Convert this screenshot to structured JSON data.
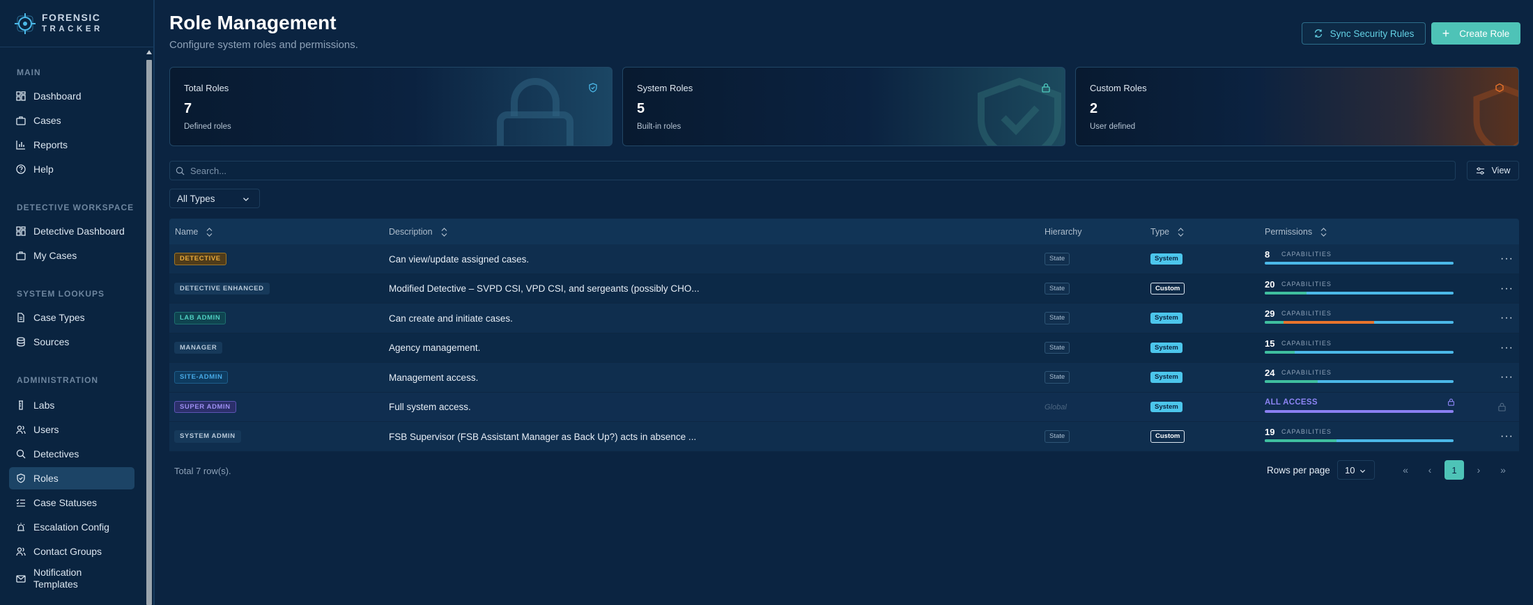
{
  "brand": {
    "line1": "FORENSIC",
    "line2": "TRACKER"
  },
  "sidebar": {
    "sections": [
      {
        "title": "MAIN",
        "items": [
          {
            "label": "Dashboard",
            "icon": "dashboard-icon"
          },
          {
            "label": "Cases",
            "icon": "briefcase-icon"
          },
          {
            "label": "Reports",
            "icon": "bar-chart-icon"
          },
          {
            "label": "Help",
            "icon": "help-circle-icon"
          }
        ]
      },
      {
        "title": "DETECTIVE WORKSPACE",
        "items": [
          {
            "label": "Detective Dashboard",
            "icon": "dashboard-icon"
          },
          {
            "label": "My Cases",
            "icon": "briefcase-icon"
          }
        ]
      },
      {
        "title": "SYSTEM LOOKUPS",
        "items": [
          {
            "label": "Case Types",
            "icon": "file-icon"
          },
          {
            "label": "Sources",
            "icon": "database-icon"
          }
        ]
      },
      {
        "title": "ADMINISTRATION",
        "items": [
          {
            "label": "Labs",
            "icon": "flask-icon"
          },
          {
            "label": "Users",
            "icon": "users-icon"
          },
          {
            "label": "Detectives",
            "icon": "search-icon"
          },
          {
            "label": "Roles",
            "icon": "shield-check-icon",
            "active": true
          },
          {
            "label": "Case Statuses",
            "icon": "list-check-icon"
          },
          {
            "label": "Escalation Config",
            "icon": "siren-icon"
          },
          {
            "label": "Contact Groups",
            "icon": "users-icon"
          },
          {
            "label": "Notification Templates",
            "icon": "mail-icon"
          }
        ]
      }
    ]
  },
  "header": {
    "title": "Role Management",
    "subtitle": "Configure system roles and permissions.",
    "sync_label": "Sync Security Rules",
    "create_label": "Create Role"
  },
  "stats": [
    {
      "label": "Total Roles",
      "value": "7",
      "sub": "Defined roles",
      "icon": "shield-check-icon",
      "accent": "#4bb8e8"
    },
    {
      "label": "System Roles",
      "value": "5",
      "sub": "Built-in roles",
      "icon": "lock-icon",
      "accent": "#4fcfc2"
    },
    {
      "label": "Custom Roles",
      "value": "2",
      "sub": "User defined",
      "icon": "hexagon-icon",
      "accent": "#e8742c"
    }
  ],
  "toolbar": {
    "search_placeholder": "Search...",
    "view_label": "View",
    "type_filter": "All Types"
  },
  "table": {
    "columns": [
      "Name",
      "Description",
      "Hierarchy",
      "Type",
      "Permissions"
    ],
    "capabilities_label": "CAPABILITIES",
    "rows": [
      {
        "name": "DETECTIVE",
        "badge": "amber",
        "description": "Can view/update assigned cases.",
        "hierarchy": "State",
        "type": "System",
        "count": "8",
        "teal_fraction": 0.0,
        "orange_fraction": 0.0
      },
      {
        "name": "DETECTIVE ENHANCED",
        "badge": "plain",
        "description": "Modified Detective – SVPD CSI, VPD CSI, and sergeants (possibly CHO...",
        "hierarchy": "State",
        "type": "Custom",
        "count": "20",
        "teal_fraction": 0.22,
        "orange_fraction": 0.0
      },
      {
        "name": "LAB ADMIN",
        "badge": "teal",
        "description": "Can create and initiate cases.",
        "hierarchy": "State",
        "type": "System",
        "count": "29",
        "teal_fraction": 0.1,
        "orange_fraction": 0.48
      },
      {
        "name": "MANAGER",
        "badge": "plain",
        "description": "Agency management.",
        "hierarchy": "State",
        "type": "System",
        "count": "15",
        "teal_fraction": 0.16,
        "orange_fraction": 0.0
      },
      {
        "name": "SITE-ADMIN",
        "badge": "blue",
        "description": "Management access.",
        "hierarchy": "State",
        "type": "System",
        "count": "24",
        "teal_fraction": 0.28,
        "orange_fraction": 0.0
      },
      {
        "name": "SUPER ADMIN",
        "badge": "purple",
        "description": "Full system access.",
        "hierarchy": "Global",
        "type": "System",
        "all_access": "ALL ACCESS"
      },
      {
        "name": "SYSTEM ADMIN",
        "badge": "plain",
        "description": "FSB Supervisor (FSB Assistant Manager as Back Up?) acts in absence ...",
        "hierarchy": "State",
        "type": "Custom",
        "count": "19",
        "teal_fraction": 0.38,
        "orange_fraction": 0.0
      }
    ]
  },
  "footer": {
    "total": "Total 7 row(s).",
    "rows_per_page_label": "Rows per page",
    "rows_per_page": "10",
    "current_page": "1"
  }
}
